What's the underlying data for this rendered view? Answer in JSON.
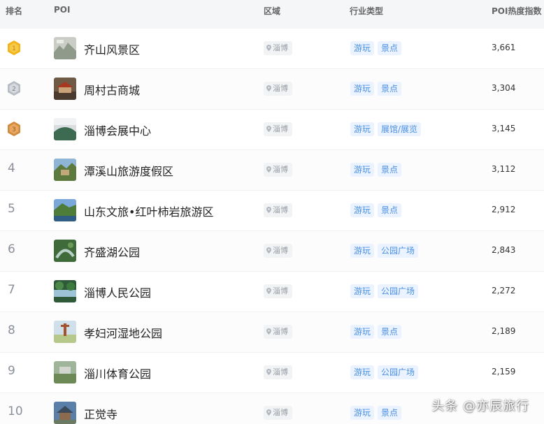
{
  "header": {
    "rank": "排名",
    "poi": "POI",
    "region": "区域",
    "industry": "行业类型",
    "heat": "POI热度指数"
  },
  "rows": [
    {
      "rank": "1",
      "name": "齐山风景区",
      "region": "淄博",
      "tags": [
        "游玩",
        "景点"
      ],
      "heat": "3,661"
    },
    {
      "rank": "2",
      "name": "周村古商城",
      "region": "淄博",
      "tags": [
        "游玩",
        "景点"
      ],
      "heat": "3,304"
    },
    {
      "rank": "3",
      "name": "淄博会展中心",
      "region": "淄博",
      "tags": [
        "游玩",
        "展馆/展览"
      ],
      "heat": "3,145"
    },
    {
      "rank": "4",
      "name": "潭溪山旅游度假区",
      "region": "淄博",
      "tags": [
        "游玩",
        "景点"
      ],
      "heat": "3,112"
    },
    {
      "rank": "5",
      "name": "山东文旅•红叶柿岩旅游区",
      "region": "淄博",
      "tags": [
        "游玩",
        "景点"
      ],
      "heat": "2,912"
    },
    {
      "rank": "6",
      "name": "齐盛湖公园",
      "region": "淄博",
      "tags": [
        "游玩",
        "公园广场"
      ],
      "heat": "2,843"
    },
    {
      "rank": "7",
      "name": "淄博人民公园",
      "region": "淄博",
      "tags": [
        "游玩",
        "公园广场"
      ],
      "heat": "2,272"
    },
    {
      "rank": "8",
      "name": "孝妇河湿地公园",
      "region": "淄博",
      "tags": [
        "游玩",
        "景点"
      ],
      "heat": "2,189"
    },
    {
      "rank": "9",
      "name": "淄川体育公园",
      "region": "淄博",
      "tags": [
        "游玩",
        "公园广场"
      ],
      "heat": "2,159"
    },
    {
      "rank": "10",
      "name": "正觉寺",
      "region": "淄博",
      "tags": [
        "游玩",
        "景点"
      ],
      "heat": ""
    }
  ],
  "watermark": "头条 @亦辰旅行",
  "colors": {
    "tag_bg": "#eaf3ff",
    "tag_text": "#4a8fe0",
    "gold": "#f2b319",
    "silver": "#b7bcc4",
    "bronze": "#d28a3c"
  }
}
